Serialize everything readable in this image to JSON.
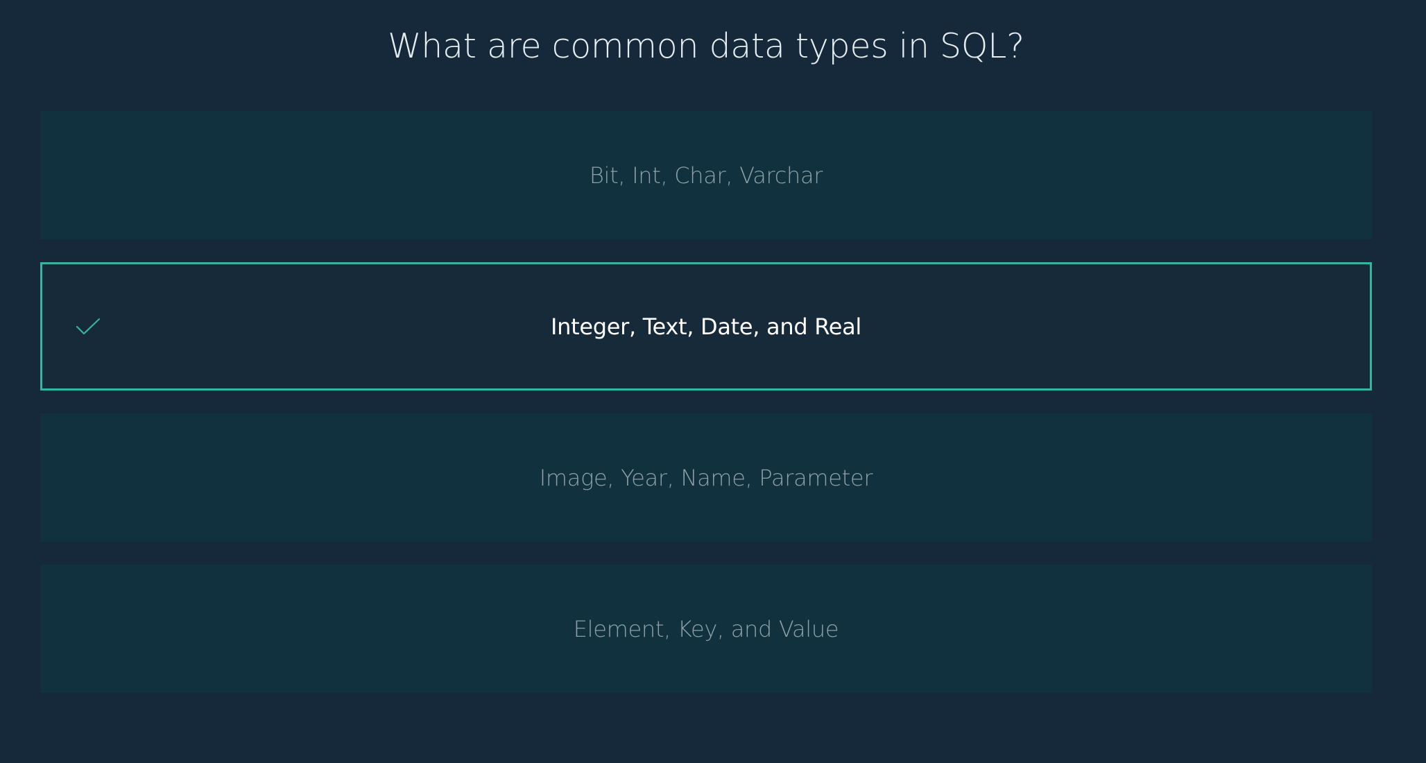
{
  "question": {
    "text": "What are common data types in SQL?"
  },
  "options": [
    {
      "label": "Bit, Int, Char, Varchar",
      "selected": false
    },
    {
      "label": "Integer, Text, Date, and Real",
      "selected": true
    },
    {
      "label": "Image, Year, Name, Parameter",
      "selected": false
    },
    {
      "label": "Element, Key, and Value",
      "selected": false
    }
  ],
  "icons": {
    "selected_marker": "check-icon"
  },
  "colors": {
    "background": "#16293a",
    "option_background": "#11313f",
    "accent": "#36b49f",
    "question_text": "#e6eef2",
    "option_text": "#8fa1a8",
    "selected_text": "#ffffff"
  }
}
